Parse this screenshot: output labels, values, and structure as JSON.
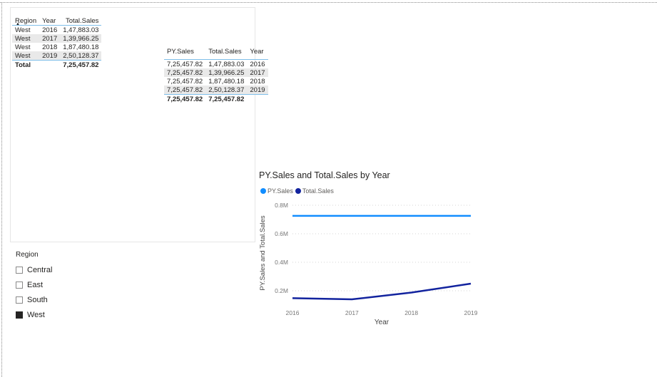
{
  "table_left": {
    "headers": [
      "Region",
      "Year",
      "Total.Sales"
    ],
    "rows": [
      [
        "West",
        "2016",
        "1,47,883.03"
      ],
      [
        "West",
        "2017",
        "1,39,966.25"
      ],
      [
        "West",
        "2018",
        "1,87,480.18"
      ],
      [
        "West",
        "2019",
        "2,50,128.37"
      ]
    ],
    "total_label": "Total",
    "total_value": "7,25,457.82"
  },
  "table_right": {
    "headers": [
      "PY.Sales",
      "Total.Sales",
      "Year"
    ],
    "rows": [
      [
        "7,25,457.82",
        "1,47,883.03",
        "2016"
      ],
      [
        "7,25,457.82",
        "1,39,966.25",
        "2017"
      ],
      [
        "7,25,457.82",
        "1,87,480.18",
        "2018"
      ],
      [
        "7,25,457.82",
        "2,50,128.37",
        "2019"
      ]
    ],
    "total": [
      "7,25,457.82",
      "7,25,457.82"
    ]
  },
  "slicer": {
    "title": "Region",
    "items": [
      {
        "label": "Central",
        "checked": false
      },
      {
        "label": "East",
        "checked": false
      },
      {
        "label": "South",
        "checked": false
      },
      {
        "label": "West",
        "checked": true
      }
    ]
  },
  "chart": {
    "title": "PY.Sales and Total.Sales by Year",
    "legend": [
      "PY.Sales",
      "Total.Sales"
    ]
  },
  "chart_data": {
    "type": "line",
    "title": "PY.Sales and Total.Sales by Year",
    "xlabel": "Year",
    "ylabel": "PY.Sales and Total.Sales",
    "x": [
      2016,
      2017,
      2018,
      2019
    ],
    "x_tick_labels": [
      "2016",
      "2017",
      "2018",
      "2019"
    ],
    "y_ticks": [
      200000,
      400000,
      600000,
      800000
    ],
    "y_tick_labels": [
      "0.2M",
      "0.4M",
      "0.6M",
      "0.8M"
    ],
    "ylim": [
      130000,
      820000
    ],
    "grid": true,
    "legend_position": "top-left",
    "series": [
      {
        "name": "PY.Sales",
        "color": "#118dff",
        "values": [
          725457.82,
          725457.82,
          725457.82,
          725457.82
        ]
      },
      {
        "name": "Total.Sales",
        "color": "#12239e",
        "values": [
          147883.03,
          139966.25,
          187480.18,
          250128.37
        ]
      }
    ]
  },
  "colors": {
    "accent": "#7fbfe9",
    "py_sales": "#118dff",
    "total_sales": "#12239e",
    "row_stripe": "#e9e9e9"
  }
}
